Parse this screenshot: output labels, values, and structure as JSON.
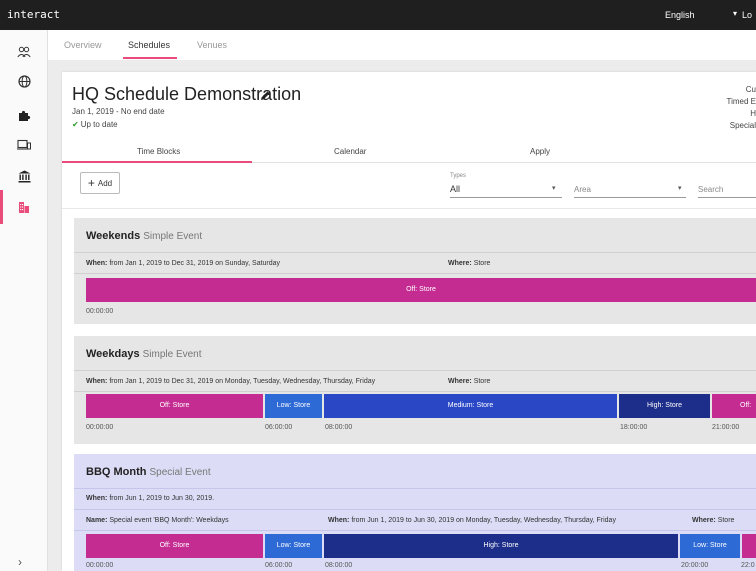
{
  "app": {
    "brand": "interact",
    "language": "English",
    "logout": "Lo"
  },
  "top_tabs": [
    {
      "label": "Overview"
    },
    {
      "label": "Schedules"
    },
    {
      "label": "Venues"
    }
  ],
  "schedule": {
    "title": "HQ Schedule Demonstration",
    "dates": "Jan 1, 2019 - No end date",
    "status": "Up to date",
    "right_meta": [
      "Cu",
      "Timed E",
      "H",
      "Special"
    ]
  },
  "sub_tabs": [
    {
      "label": "Time Blocks"
    },
    {
      "label": "Calendar"
    },
    {
      "label": "Apply"
    }
  ],
  "filters": {
    "add_label": "Add",
    "types_label": "Types",
    "types_value": "All",
    "area_placeholder": "Area",
    "search_placeholder": "Search"
  },
  "colors": {
    "off": "#c42c91",
    "low": "#2e6ad6",
    "medium": "#2a47c6",
    "high": "#1d2d8a",
    "accent": "#e94b7a"
  },
  "events": [
    {
      "name": "Weekends",
      "type": "Simple Event",
      "when_label": "When:",
      "when": "from Jan 1, 2019 to Dec 31, 2019 on Sunday, Saturday",
      "where_label": "Where:",
      "where": "Store",
      "blocks": [
        {
          "label": "Off: Store"
        }
      ],
      "ticks": [
        "00:00:00"
      ]
    },
    {
      "name": "Weekdays",
      "type": "Simple Event",
      "when_label": "When:",
      "when": "from Jan 1, 2019 to Dec 31, 2019 on Monday, Tuesday, Wednesday, Thursday, Friday",
      "where_label": "Where:",
      "where": "Store",
      "blocks": [
        {
          "label": "Off: Store"
        },
        {
          "label": "Low: Store"
        },
        {
          "label": "Medium: Store"
        },
        {
          "label": "High: Store"
        },
        {
          "label": "Off:"
        }
      ],
      "ticks": [
        "00:00:00",
        "06:00:00",
        "08:00:00",
        "18:00:00",
        "21:00:00"
      ]
    },
    {
      "name": "BBQ Month",
      "type": "Special Event",
      "when_label": "When:",
      "when": "from Jun 1, 2019 to Jun 30, 2019.",
      "sub_name_label": "Name:",
      "sub_name": "Special event 'BBQ Month': Weekdays",
      "sub_when_label": "When:",
      "sub_when": "from Jun 1, 2019 to Jun 30, 2019 on Monday, Tuesday, Wednesday, Thursday, Friday",
      "sub_where_label": "Where:",
      "sub_where": "Store",
      "blocks": [
        {
          "label": "Off: Store"
        },
        {
          "label": "Low: Store"
        },
        {
          "label": "High: Store"
        },
        {
          "label": "Low: Store"
        },
        {
          "label": ""
        }
      ],
      "ticks": [
        "00:00:00",
        "06:00:00",
        "08:00:00",
        "20:00:00",
        "22:0"
      ]
    }
  ]
}
